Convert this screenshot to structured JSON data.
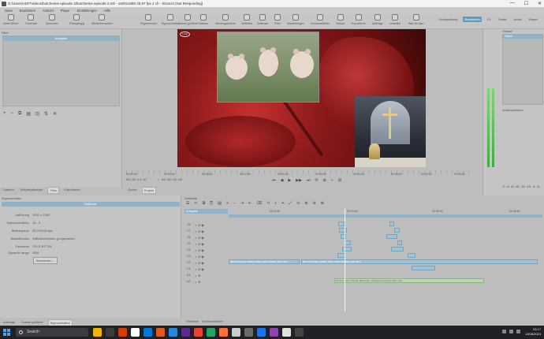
{
  "window": {
    "title": "G:/Users/ADF/Videos/butcheries episode 2/butcheries episode 2.mlt - 1920x1080 25.97 fps 2 ch - Shotcut (Not Responding)",
    "controls": [
      "—",
      "☐",
      "✕"
    ]
  },
  "menu": [
    "Datei",
    "Bearbeiten",
    "Ansicht",
    "Player",
    "Einstellungen",
    "Hilfe"
  ],
  "toolbar": {
    "items": [
      "Datei öffnen",
      "Generate",
      "Speichern",
      "Rückgängig",
      "Wiederherstellen",
      "Pegelmesser",
      "Eigenschaften",
      "Zuletzt geöffnet",
      "Notizen",
      "Wiedergabeliste",
      "Zeitleiste",
      "Zeitleiste",
      "Filter",
      "Markierungen",
      "Schlüsselbilder",
      "Verlauf",
      "Exportieren",
      "Aufträge",
      "Unterlitel",
      "Was ist das?"
    ],
    "layouts": [
      "Fertigstellung",
      "Bearbeiten",
      "FX",
      "Farbe",
      "Audio",
      "Player"
    ],
    "active_layout": "Bearbeiten"
  },
  "filter_panel": {
    "label": "Filter",
    "header": "Ausgabe",
    "tools": [
      "+",
      "−",
      "⧉",
      "▤",
      "⊡",
      "⇅",
      "✕"
    ],
    "tabs": [
      "Dateien",
      "Wiedergabeliste",
      "Filter",
      "Exportieren"
    ],
    "selected_tab": "Filter"
  },
  "preview": {
    "badge": "LIVE"
  },
  "ruler": {
    "labels": [
      "00:00:00",
      "00:04:00",
      "00:08:00",
      "00:12:00",
      "00:16:00",
      "00:20:00",
      "00:24:00",
      "00:28:00",
      "00:32:00",
      "00:35:00"
    ]
  },
  "transport": {
    "current": "00:33:13:97",
    "total": "/ 00:38:25:66",
    "controls": [
      "⏮",
      "◀",
      "▶",
      "▶▶",
      "⏭",
      "⟳",
      "⊕",
      "⌁",
      "⊞"
    ],
    "tabs": [
      "Quelle",
      "Projekt"
    ],
    "selected_tab": "Projekt"
  },
  "right_panel": {
    "verlauf_title": "Verlauf",
    "verlauf_item": "Clipart",
    "spectrum_title": "Audiospektrum",
    "spectrum_labels": [
      "20",
      "40",
      "80",
      "160",
      "315",
      "630",
      "1k",
      "2k",
      "4k",
      "8k",
      "16k"
    ]
  },
  "properties": {
    "title": "Eigenschaften",
    "header": "Zeitleiste",
    "rows": [
      {
        "k": "Auflösung",
        "v": "1920 x 1080"
      },
      {
        "k": "Seitenverhältnis",
        "v": "16 : 9"
      },
      {
        "k": "Bildfrequenz",
        "v": "25.970025 fps"
      },
      {
        "k": "Abtastmodus",
        "v": "Vollbildverfahren (progressive)"
      },
      {
        "k": "Farbraum",
        "v": "ITU-R BT.709"
      },
      {
        "k": "Dynamic range",
        "v": "SDR"
      }
    ],
    "edit_button": "Bearbeiten...",
    "tabs": [
      "Aufträge",
      "Zuletzt geöffnet",
      "Eigenschaften"
    ]
  },
  "timeline": {
    "title": "Zeitleiste",
    "tools": [
      "☰",
      "✂",
      "⧉",
      "⎘",
      "▤",
      "+",
      "−",
      "⇥",
      "⇤",
      "⌫",
      "⊓",
      "◐",
      "⌖",
      "⤢",
      "⊙",
      "⊚",
      "⊖",
      "⊕"
    ],
    "output_label": "Ausgabe",
    "ruler": [
      "00:11:55",
      "00:23:00",
      "00:35:00",
      "00:46:50"
    ],
    "tracks": [
      "V8",
      "V7",
      "V6",
      "V5",
      "V4",
      "V3",
      "V2",
      "V1",
      "A1",
      "A2"
    ],
    "clip_label": "99mm butchery 1080p_15fps_H264-128kbit_AAC.mp4",
    "audio_clip_label": "Drowsy Detroit Beach Marsupial - Background Music (HD).mp3",
    "tabs": [
      "Zeitleiste",
      "Schlüsselbilder"
    ]
  },
  "taskbar": {
    "search": "Search",
    "time": "23:17",
    "date": "13/08/2024",
    "app_colors": [
      "#f0b400",
      "#3c3c3c",
      "#d83b01",
      "#ffffff",
      "#0078d4",
      "#e35a1f",
      "#2b88d8",
      "#5b2c8f",
      "#ea4335",
      "#25a366",
      "#ff7139",
      "#cccccc",
      "#6b6b6b",
      "#1a73e8",
      "#8e44ad",
      "#e0e0e0",
      "#444444"
    ]
  }
}
